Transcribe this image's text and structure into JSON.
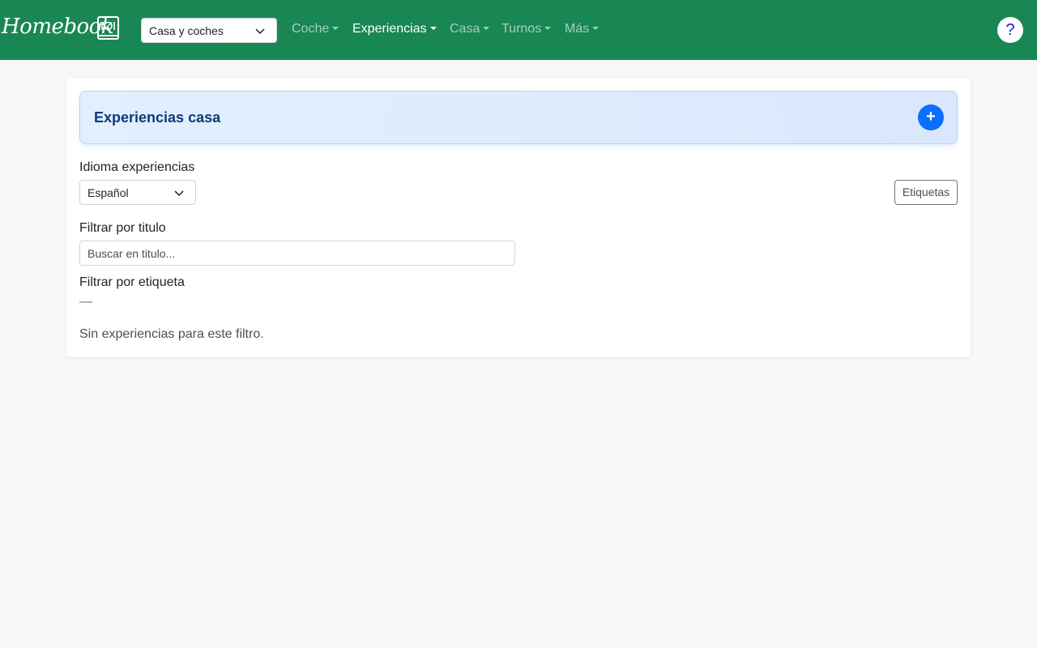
{
  "navbar": {
    "brand": "Homebook",
    "brand_icon": "dining-book-icon",
    "house_select_value": "Casa y coches",
    "menu": [
      {
        "label": "Coche",
        "active": false
      },
      {
        "label": "Experiencias",
        "active": true
      },
      {
        "label": "Casa",
        "active": false
      },
      {
        "label": "Turnos",
        "active": false
      },
      {
        "label": "Más",
        "active": false
      }
    ],
    "help_label": "?"
  },
  "card": {
    "title": "Experiencias casa",
    "add_label": "+",
    "language_label": "Idioma experiencias",
    "language_value": "Español",
    "tags_button": "Etiquetas",
    "title_filter_label": "Filtrar por titulo",
    "title_filter_placeholder": "Buscar en titulo...",
    "tag_filter_label": "Filtrar por etiqueta",
    "tag_filter_value": "—",
    "empty_message": "Sin experiencias para este filtro."
  },
  "colors": {
    "navbar": "#198754",
    "accent": "#0d6efd",
    "page_background": "#f6f7f9"
  }
}
